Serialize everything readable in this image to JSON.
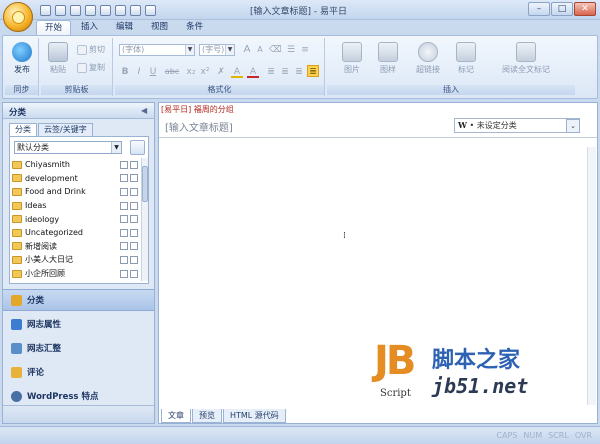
{
  "window": {
    "title": "[输入文章标题] - 易平日",
    "min": "–",
    "max": "□",
    "close": "✕"
  },
  "tabs": [
    "开始",
    "插入",
    "编辑",
    "视图",
    "条件"
  ],
  "ribbon": {
    "publish": {
      "label": "发布",
      "group": "同步"
    },
    "clipboard": {
      "paste": "粘贴",
      "cut": "剪切",
      "copy": "复制",
      "group": "剪贴板"
    },
    "format": {
      "font": "(字体)",
      "size": "(字号)",
      "group": "格式化",
      "bold": "B",
      "italic": "I",
      "underline": "U",
      "strike": "abc",
      "sub": "x₂",
      "sup": "x²",
      "grow": "A",
      "shrink": "A",
      "color": "A",
      "highlight": "A"
    },
    "insert": {
      "image": "图片",
      "table": "图样",
      "hyperlink": "超链接",
      "tag": "标记",
      "readmore": "阅读全文标记",
      "group": "插入"
    }
  },
  "left": {
    "header": "分类",
    "tabs": [
      "分类",
      "云签/关键字"
    ],
    "select": "默认分类",
    "categories": [
      "Chiyasmith",
      "development",
      "Food and Drink",
      "Ideas",
      "ideology",
      "Uncategorized",
      "新增阅读",
      "小美人大日记",
      "小企所回顾"
    ],
    "nav": [
      "分类",
      "网志属性",
      "网志汇整",
      "评论",
      "WordPress 特点"
    ]
  },
  "editor": {
    "crumb": "[易平日] 福周的分组",
    "title_placeholder": "[输入文章标题]",
    "tag_prefix": "W",
    "tag_text": "• 未设定分类",
    "cursor": "⁞",
    "tabs": [
      "文章",
      "预览",
      "HTML 源代码"
    ]
  },
  "watermark": {
    "logo": "JB",
    "script": "Script",
    "site_cn": "脚本之家",
    "url": "jb51.net"
  },
  "status": [
    "CAPS",
    "NUM",
    "SCRL",
    "OVR"
  ]
}
